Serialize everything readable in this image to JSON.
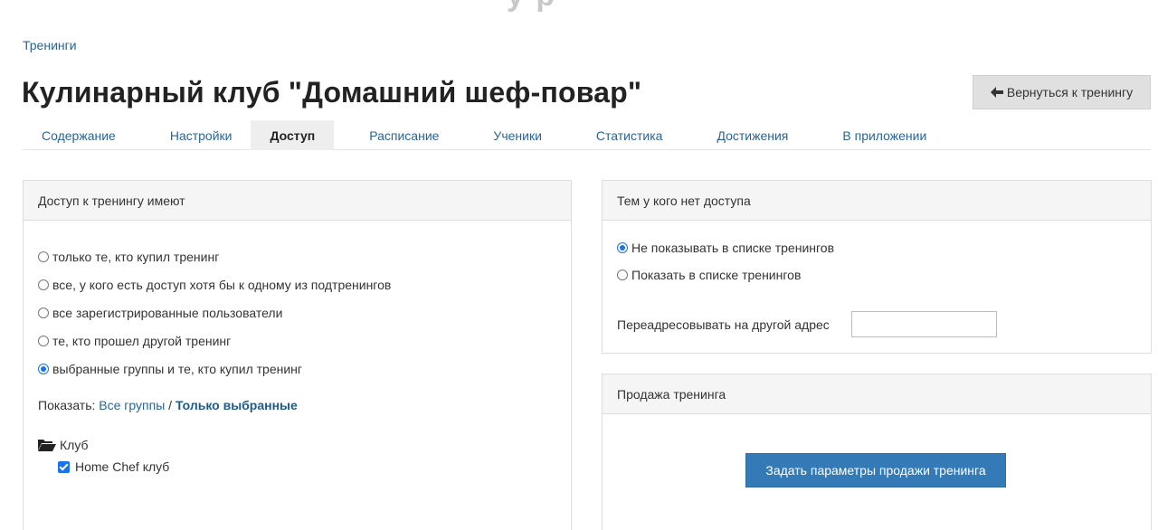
{
  "breadcrumb": "Тренинги",
  "page_title": "Кулинарный клуб \"Домашний шеф-повар\"",
  "back_button": {
    "label": "Вернуться к тренингу",
    "icon": "arrow-left-icon"
  },
  "tabs": [
    {
      "label": "Содержание",
      "active": false
    },
    {
      "label": "Настройки",
      "active": false
    },
    {
      "label": "Доступ",
      "active": true
    },
    {
      "label": "Расписание",
      "active": false
    },
    {
      "label": "Ученики",
      "active": false
    },
    {
      "label": "Статистика",
      "active": false
    },
    {
      "label": "Достижения",
      "active": false
    },
    {
      "label": "В приложении",
      "active": false
    }
  ],
  "access_panel": {
    "title": "Доступ к тренингу имеют",
    "options": [
      {
        "label": "только те, кто купил тренинг",
        "checked": false
      },
      {
        "label": "все, у кого есть доступ хотя бы к одному из подтренингов",
        "checked": false
      },
      {
        "label": "все зарегистрированные пользователи",
        "checked": false
      },
      {
        "label": "те, кто прошел другой тренинг",
        "checked": false
      },
      {
        "label": "выбранные группы и те, кто купил тренинг",
        "checked": true
      }
    ],
    "show_label": "Показать:",
    "show_all": "Все группы",
    "show_sep": " / ",
    "show_selected": "Только выбранные",
    "folder": {
      "label": "Клуб",
      "icon": "folder-open-icon"
    },
    "group": {
      "label": "Home Chef клуб",
      "checked": true
    }
  },
  "no_access_panel": {
    "title": "Тем у кого нет доступа",
    "options": [
      {
        "label": "Не показывать в списке тренингов",
        "checked": true
      },
      {
        "label": "Показать в списке тренингов",
        "checked": false
      }
    ],
    "redirect_label": "Переадресовывать на другой адрес",
    "redirect_value": ""
  },
  "sale_panel": {
    "title": "Продажа тренинга",
    "button_label": "Задать параметры продажи тренинга"
  },
  "colors": {
    "link": "#2a6496",
    "primary_button": "#337ab7",
    "radio_checked": "#1a73e8"
  }
}
